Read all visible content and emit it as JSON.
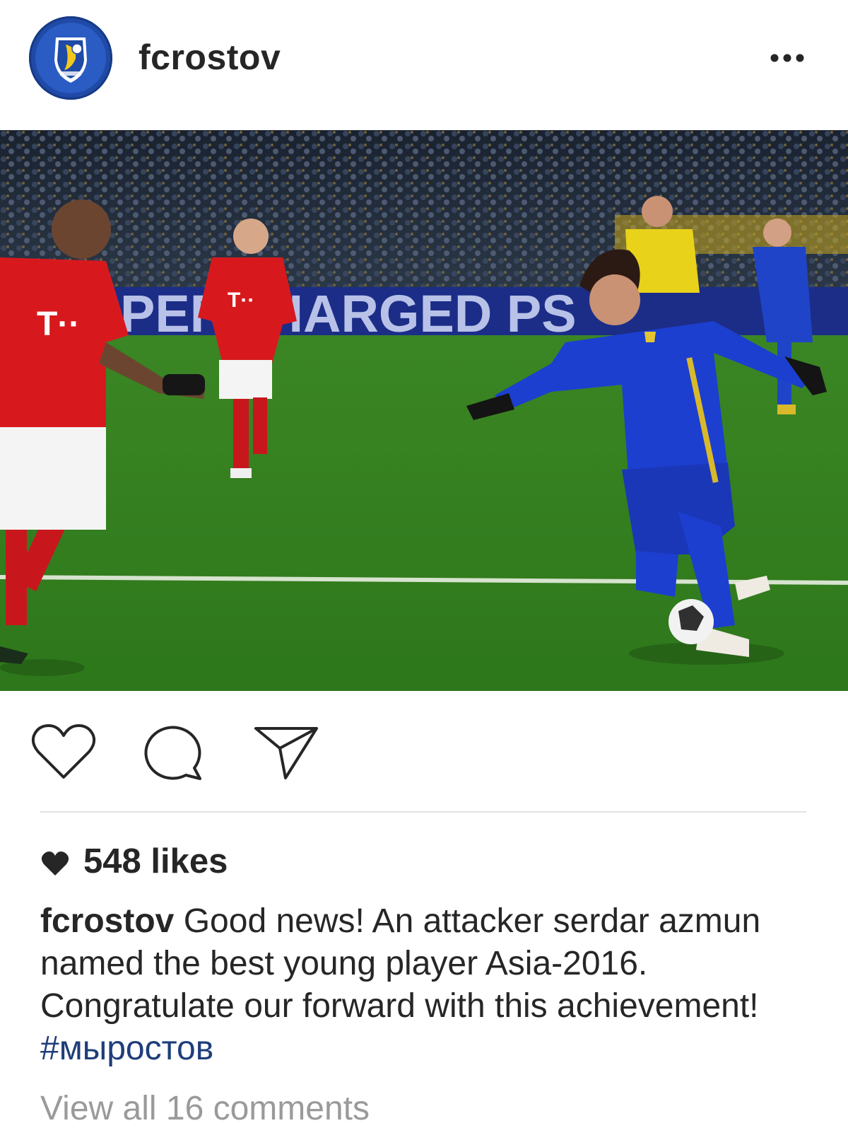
{
  "post": {
    "username": "fcrostov",
    "avatar_icon": "fc-rostov-crest-logo",
    "more_icon": "more-options-icon",
    "image_description_icon": "photo",
    "actions": {
      "like_icon": "heart-outline-icon",
      "comment_icon": "comment-bubble-icon",
      "share_icon": "send-paper-plane-icon"
    },
    "likes_icon": "heart-filled-icon",
    "likes_text": "548 likes",
    "caption": {
      "username": "fcrostov",
      "text": " Good news! An attacker serdar azmun named the best young player Asia-2016. Congratulate our forward with this achievement! ",
      "hashtag": "#мыростов"
    },
    "view_comments": "View all 16 comments",
    "photo": {
      "banner_text": "PERCHARGED PS"
    }
  },
  "colors": {
    "bayern_red": "#d7191e",
    "rostov_blue": "#1c3fd0",
    "pitch_green": "#3e8a25",
    "hashtag_blue": "#1f3d7a"
  }
}
